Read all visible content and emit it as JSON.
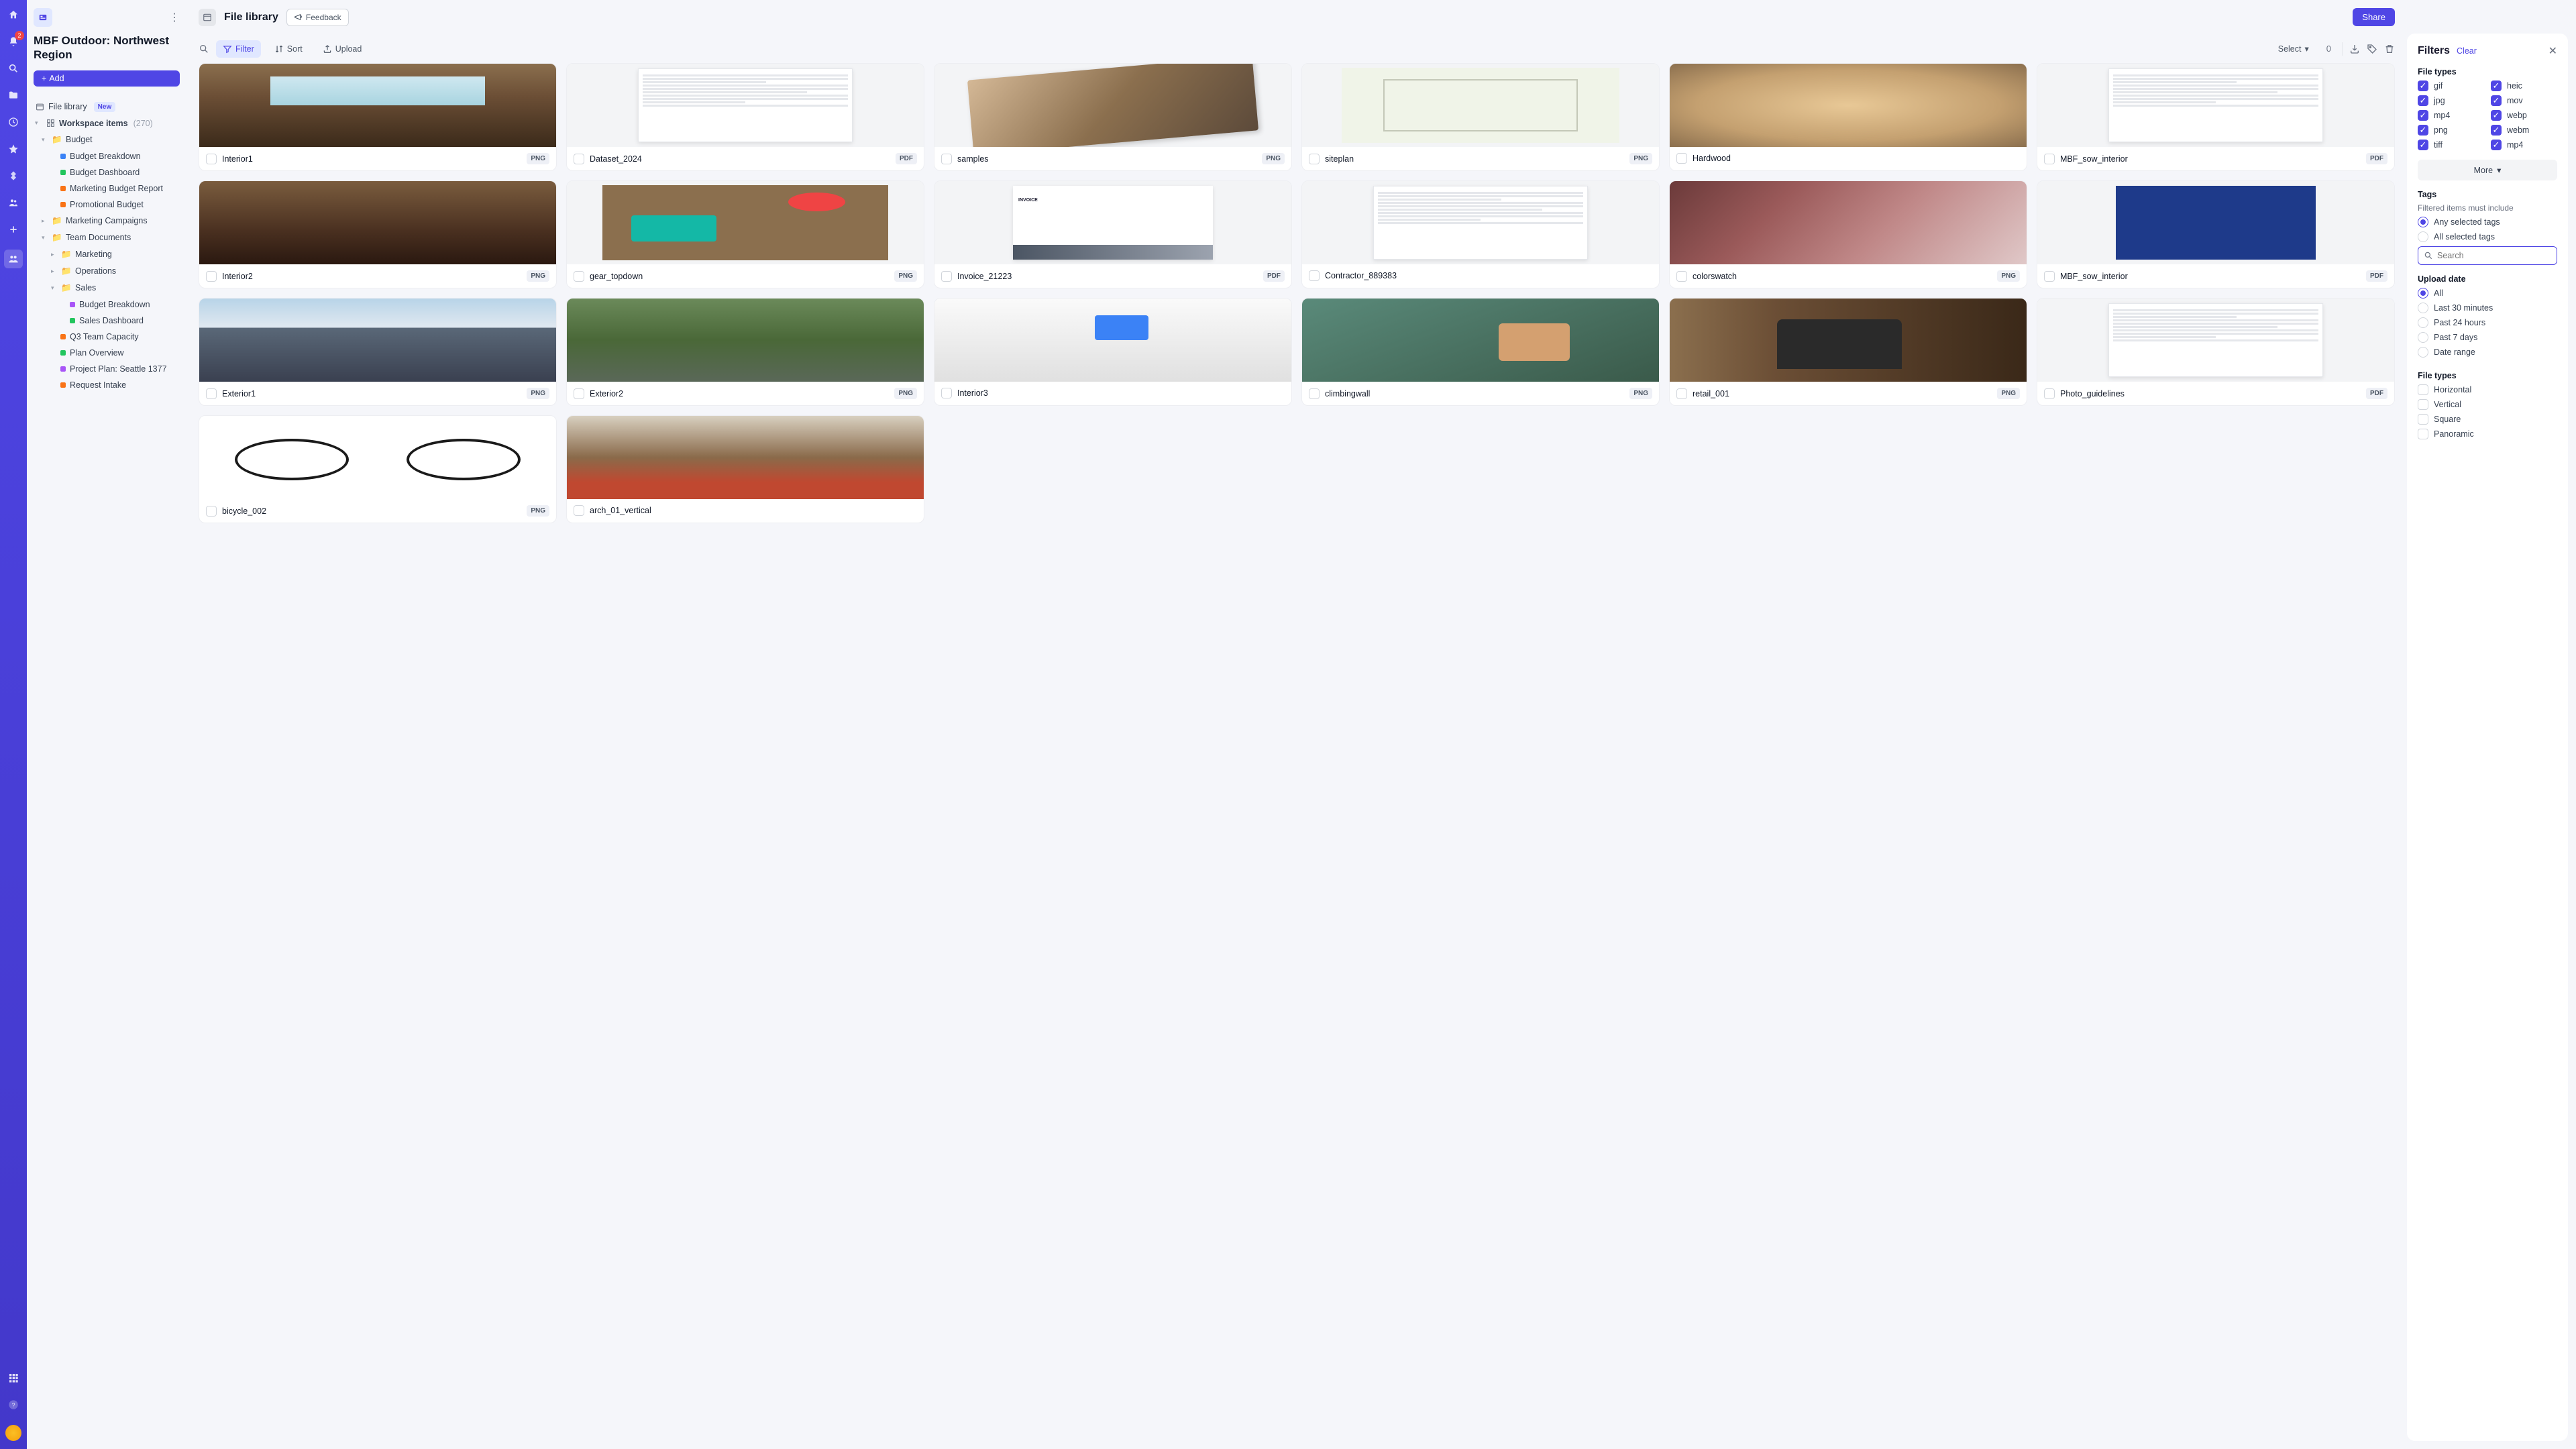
{
  "rail": {
    "badge": "2"
  },
  "sidebar": {
    "title": "MBF Outdoor: Northwest Region",
    "add_label": "Add",
    "file_library_label": "File library",
    "new_badge": "New",
    "workspace_label": "Workspace items",
    "workspace_count": "(270)",
    "tree": {
      "budget": "Budget",
      "budget_breakdown": "Budget Breakdown",
      "budget_dashboard": "Budget Dashboard",
      "marketing_budget_report": "Marketing Budget Report",
      "promotional_budget": "Promotional Budget",
      "marketing_campaigns": "Marketing Campaigns",
      "team_documents": "Team Documents",
      "marketing": "Marketing",
      "operations": "Operations",
      "sales": "Sales",
      "sales_budget_breakdown": "Budget Breakdown",
      "sales_dashboard": "Sales Dashboard",
      "q3_capacity": "Q3 Team Capacity",
      "plan_overview": "Plan Overview",
      "project_plan": "Project Plan: Seattle 1377",
      "request_intake": "Request Intake"
    }
  },
  "topbar": {
    "title": "File library",
    "feedback": "Feedback",
    "share": "Share"
  },
  "toolbar": {
    "filter": "Filter",
    "sort": "Sort",
    "upload": "Upload",
    "select": "Select",
    "count": "0"
  },
  "files": [
    {
      "name": "Interior1",
      "type": "PNG",
      "thumb": "interior1"
    },
    {
      "name": "Dataset_2024",
      "type": "PDF",
      "thumb": "doc"
    },
    {
      "name": "samples",
      "type": "PNG",
      "thumb": "samples"
    },
    {
      "name": "siteplan",
      "type": "PNG",
      "thumb": "siteplan"
    },
    {
      "name": "Hardwood",
      "type": "",
      "thumb": "hardwood"
    },
    {
      "name": "MBF_sow_interior",
      "type": "PDF",
      "thumb": "doc"
    },
    {
      "name": "Interior2",
      "type": "PNG",
      "thumb": "photo2"
    },
    {
      "name": "gear_topdown",
      "type": "PNG",
      "thumb": "gear"
    },
    {
      "name": "Invoice_21223",
      "type": "PDF",
      "thumb": "invoice"
    },
    {
      "name": "Contractor_889383",
      "type": "",
      "thumb": "doc"
    },
    {
      "name": "colorswatch",
      "type": "PNG",
      "thumb": "colorswatch"
    },
    {
      "name": "MBF_sow_interior",
      "type": "PDF",
      "thumb": "bluedoc"
    },
    {
      "name": "Exterior1",
      "type": "PNG",
      "thumb": "ext1"
    },
    {
      "name": "Exterior2",
      "type": "PNG",
      "thumb": "ext2"
    },
    {
      "name": "Interior3",
      "type": "",
      "thumb": "int3"
    },
    {
      "name": "climbingwall",
      "type": "PNG",
      "thumb": "climb"
    },
    {
      "name": "retail_001",
      "type": "PNG",
      "thumb": "retail"
    },
    {
      "name": "Photo_guidelines",
      "type": "PDF",
      "thumb": "doc"
    },
    {
      "name": "bicycle_002",
      "type": "PNG",
      "thumb": "bike"
    },
    {
      "name": "arch_01_vertical",
      "type": "",
      "thumb": "arch"
    }
  ],
  "filters": {
    "title": "Filters",
    "clear": "Clear",
    "file_types_label": "File types",
    "types": [
      {
        "label": "gif",
        "checked": true
      },
      {
        "label": "heic",
        "checked": true
      },
      {
        "label": "jpg",
        "checked": true
      },
      {
        "label": "mov",
        "checked": true
      },
      {
        "label": "mp4",
        "checked": true
      },
      {
        "label": "webp",
        "checked": true
      },
      {
        "label": "png",
        "checked": true
      },
      {
        "label": "webm",
        "checked": true
      },
      {
        "label": "tiff",
        "checked": true
      },
      {
        "label": "mp4",
        "checked": true
      }
    ],
    "more": "More",
    "tags_label": "Tags",
    "tags_sub": "Filtered items must include",
    "tags_any": "Any selected tags",
    "tags_all": "All selected tags",
    "search_placeholder": "Search",
    "upload_date_label": "Upload date",
    "dates": [
      {
        "label": "All",
        "checked": true
      },
      {
        "label": "Last 30 minutes",
        "checked": false
      },
      {
        "label": "Past 24 hours",
        "checked": false
      },
      {
        "label": "Past 7 days",
        "checked": false
      },
      {
        "label": "Date range",
        "checked": false
      }
    ],
    "orientation_label": "File types",
    "orientations": [
      {
        "label": "Horizontal"
      },
      {
        "label": "Vertical"
      },
      {
        "label": "Square"
      },
      {
        "label": "Panoramic"
      }
    ]
  },
  "colors": {
    "dots": [
      "#3b82f6",
      "#22c55e",
      "#f97316",
      "#f97316",
      "#a855f7",
      "#22c55e",
      "#f97316",
      "#22c55e",
      "#a855f7",
      "#f97316"
    ]
  }
}
